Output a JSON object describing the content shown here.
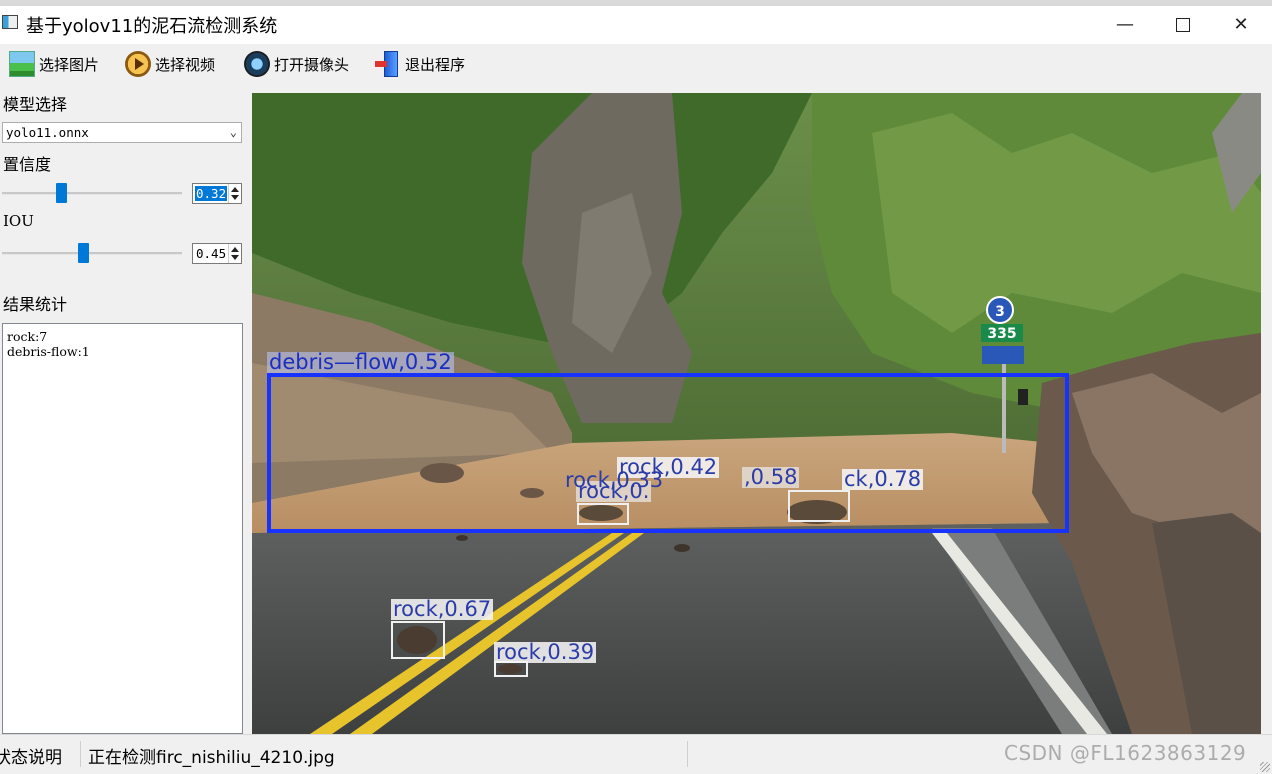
{
  "window": {
    "title": "基于yolov11的泥石流检测系统",
    "minimize": "—",
    "close": "✕"
  },
  "toolbar": {
    "select_image": "选择图片",
    "select_video": "选择视频",
    "open_camera": "打开摄像头",
    "exit": "退出程序"
  },
  "sidebar": {
    "model_label": "模型选择",
    "model_value": "yolo11.onnx",
    "confidence_label": "置信度",
    "confidence_value": "0.32",
    "confidence_level": 0.32,
    "iou_label": "IOU",
    "iou_value": "0.45",
    "iou_level": 0.45,
    "results_label": "结果统计",
    "results": [
      "rock:7",
      "debris-flow:1"
    ]
  },
  "detections": {
    "debris_flow": "debris—flow,0.52",
    "rock_1": "rock,0.42",
    "rock_2": "rock,0.33",
    "rock_3": "rock,0.",
    "rock_4": ",0.58",
    "rock_5": "ck,0.78",
    "rock_6": "rock,0.67",
    "rock_7": "rock,0.39",
    "sign_number": "3",
    "sign_km": "335"
  },
  "status": {
    "label": "状态说明",
    "text": "正在检测firc_nishiliu_4210.jpg",
    "watermark": "CSDN @FL1623863129"
  },
  "colors": {
    "accent": "#0078d7",
    "detection_box": "#1832ff"
  }
}
